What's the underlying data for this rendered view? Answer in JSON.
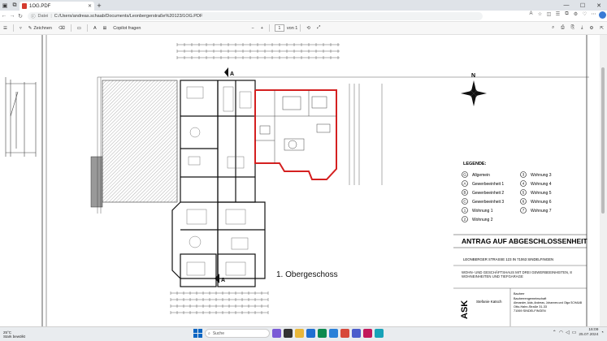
{
  "browser": {
    "tab_title": "1OG.PDF",
    "address_label": "Datei",
    "url": "C:/Users/andreas.schaab/Documents/Leonbergerstraße%20123/1OG.PDF"
  },
  "pdf_toolbar": {
    "draw_label": "Zeichnen",
    "copilot_label": "Copilot fragen",
    "page_current": "1",
    "page_total": "von 1",
    "zoom_minus": "−",
    "zoom_plus": "+"
  },
  "drawing": {
    "floor_label": "1. Obergeschoss",
    "section_marker": "A",
    "legend_title": "LEGENDE:",
    "legend_items": [
      {
        "sym": "G",
        "text": "Allgemein"
      },
      {
        "sym": "A",
        "text": "Gewerbeeinheit 1"
      },
      {
        "sym": "B",
        "text": "Gewerbeeinheit 2"
      },
      {
        "sym": "C",
        "text": "Gewerbeeinheit 3"
      },
      {
        "sym": "1",
        "text": "Wohnung 1"
      },
      {
        "sym": "2",
        "text": "Wohnung 2"
      },
      {
        "sym": "3",
        "text": "Wohnung 3"
      },
      {
        "sym": "4",
        "text": "Wohnung 4"
      },
      {
        "sym": "5",
        "text": "Wohnung 5"
      },
      {
        "sym": "6",
        "text": "Wohnung 6"
      },
      {
        "sym": "7",
        "text": "Wohnung 7"
      }
    ],
    "title_block": {
      "heading": "ANTRAG AUF ABGESCHLOSSENHEIT",
      "address": "LEONBERGER STRASSE 123 IN 71063 SINDELFINGEN",
      "project": "WOHN- UND GESCHÄFTSHAUS MIT DREI GEWERBEEINHEITEN, 8 WOHNEINHEITEN UND TIEFGARAGE",
      "logo": "ASK",
      "office_name": "Stefanie Katsch",
      "client_label": "Bauherr",
      "client_lines": [
        "Bauherrengemeinschaft",
        "Alexander, Aida, Andreas, Johannes und Olga SCHAAB",
        "Otto-Hahn-Straße 31-33",
        "71069 SINDELFINGEN"
      ]
    }
  },
  "taskbar": {
    "weather_temp": "25°C",
    "weather_text": "Stark bewölkt",
    "search_placeholder": "Suche",
    "time": "16:09",
    "date": "25.07.2024"
  },
  "colors": {
    "accent": "#0a65c2",
    "highlight": "#d42020",
    "pdf_red": "#d43b2f"
  }
}
